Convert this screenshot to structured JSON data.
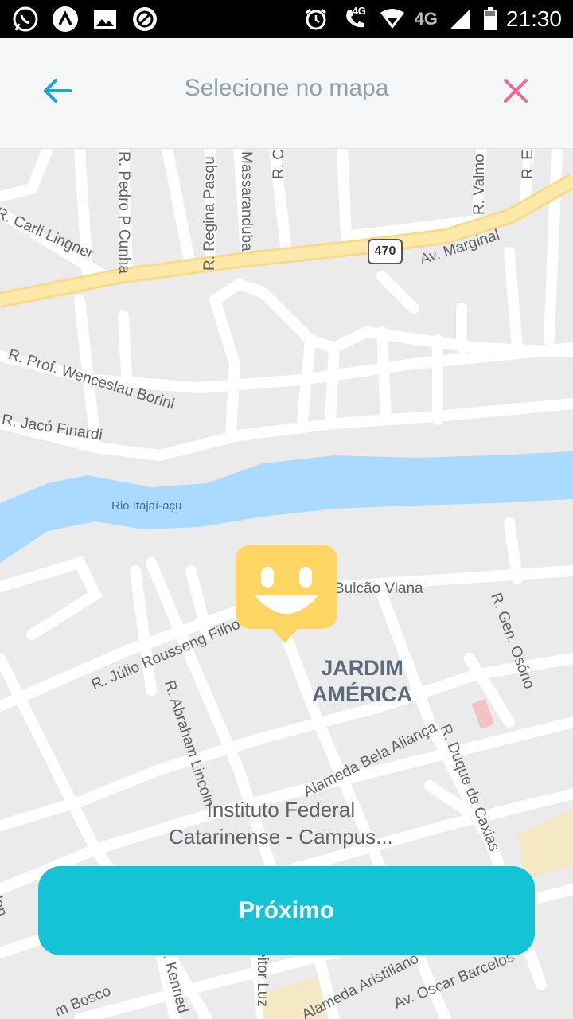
{
  "status_bar": {
    "time": "21:30",
    "network": "4G",
    "network2": "4G",
    "left_icons": [
      "whatsapp-icon",
      "arch-icon",
      "gallery-icon",
      "blocked-icon"
    ],
    "right_icons": [
      "alarm-icon",
      "call-4g-icon",
      "wifi-icon",
      "signal-icon",
      "battery-icon"
    ]
  },
  "header": {
    "title": "Selecione no mapa",
    "back_icon": "arrow-left-icon",
    "close_icon": "close-icon",
    "accent_back": "#1aa7d6",
    "accent_close": "#f06a93"
  },
  "map": {
    "streets": [
      "R. Carli Lingner",
      "R. Pedro P Cunha",
      "R. Regina Pasqu",
      "Massaranduba",
      "R. C",
      "R. Valmo",
      "R. E",
      "Av. Marginal",
      "R. Prof. Wenceslau Borini",
      "R. Jacó Finardi",
      "Bulcão Viana",
      "R. Júlio Rousseng Filho",
      "R. Gen. Osório",
      "R. Abraham Lincoln",
      "Alameda Bela Aliança",
      "R. Duque de Caxias",
      "Alameda Aristiliano",
      "Av. Oscar Barcelos",
      "ndon",
      "m Bosco",
      "s. Kenned",
      "eitor Luz"
    ],
    "route_shield": "470",
    "river": "Rio Itajaí-açu",
    "district": [
      "JARDIM",
      "AMÉRICA"
    ],
    "poi": [
      "Instituto Federal",
      "Catarinense -  Campus..."
    ],
    "colors": {
      "land": "#ebebeb",
      "road": "#ffffff",
      "highway": "#fde293",
      "water": "#aadaff"
    }
  },
  "marker": {
    "icon": "smiley-location-marker-icon",
    "color": "#ffd564"
  },
  "cta": {
    "label": "Próximo",
    "color": "#14c4d6"
  }
}
